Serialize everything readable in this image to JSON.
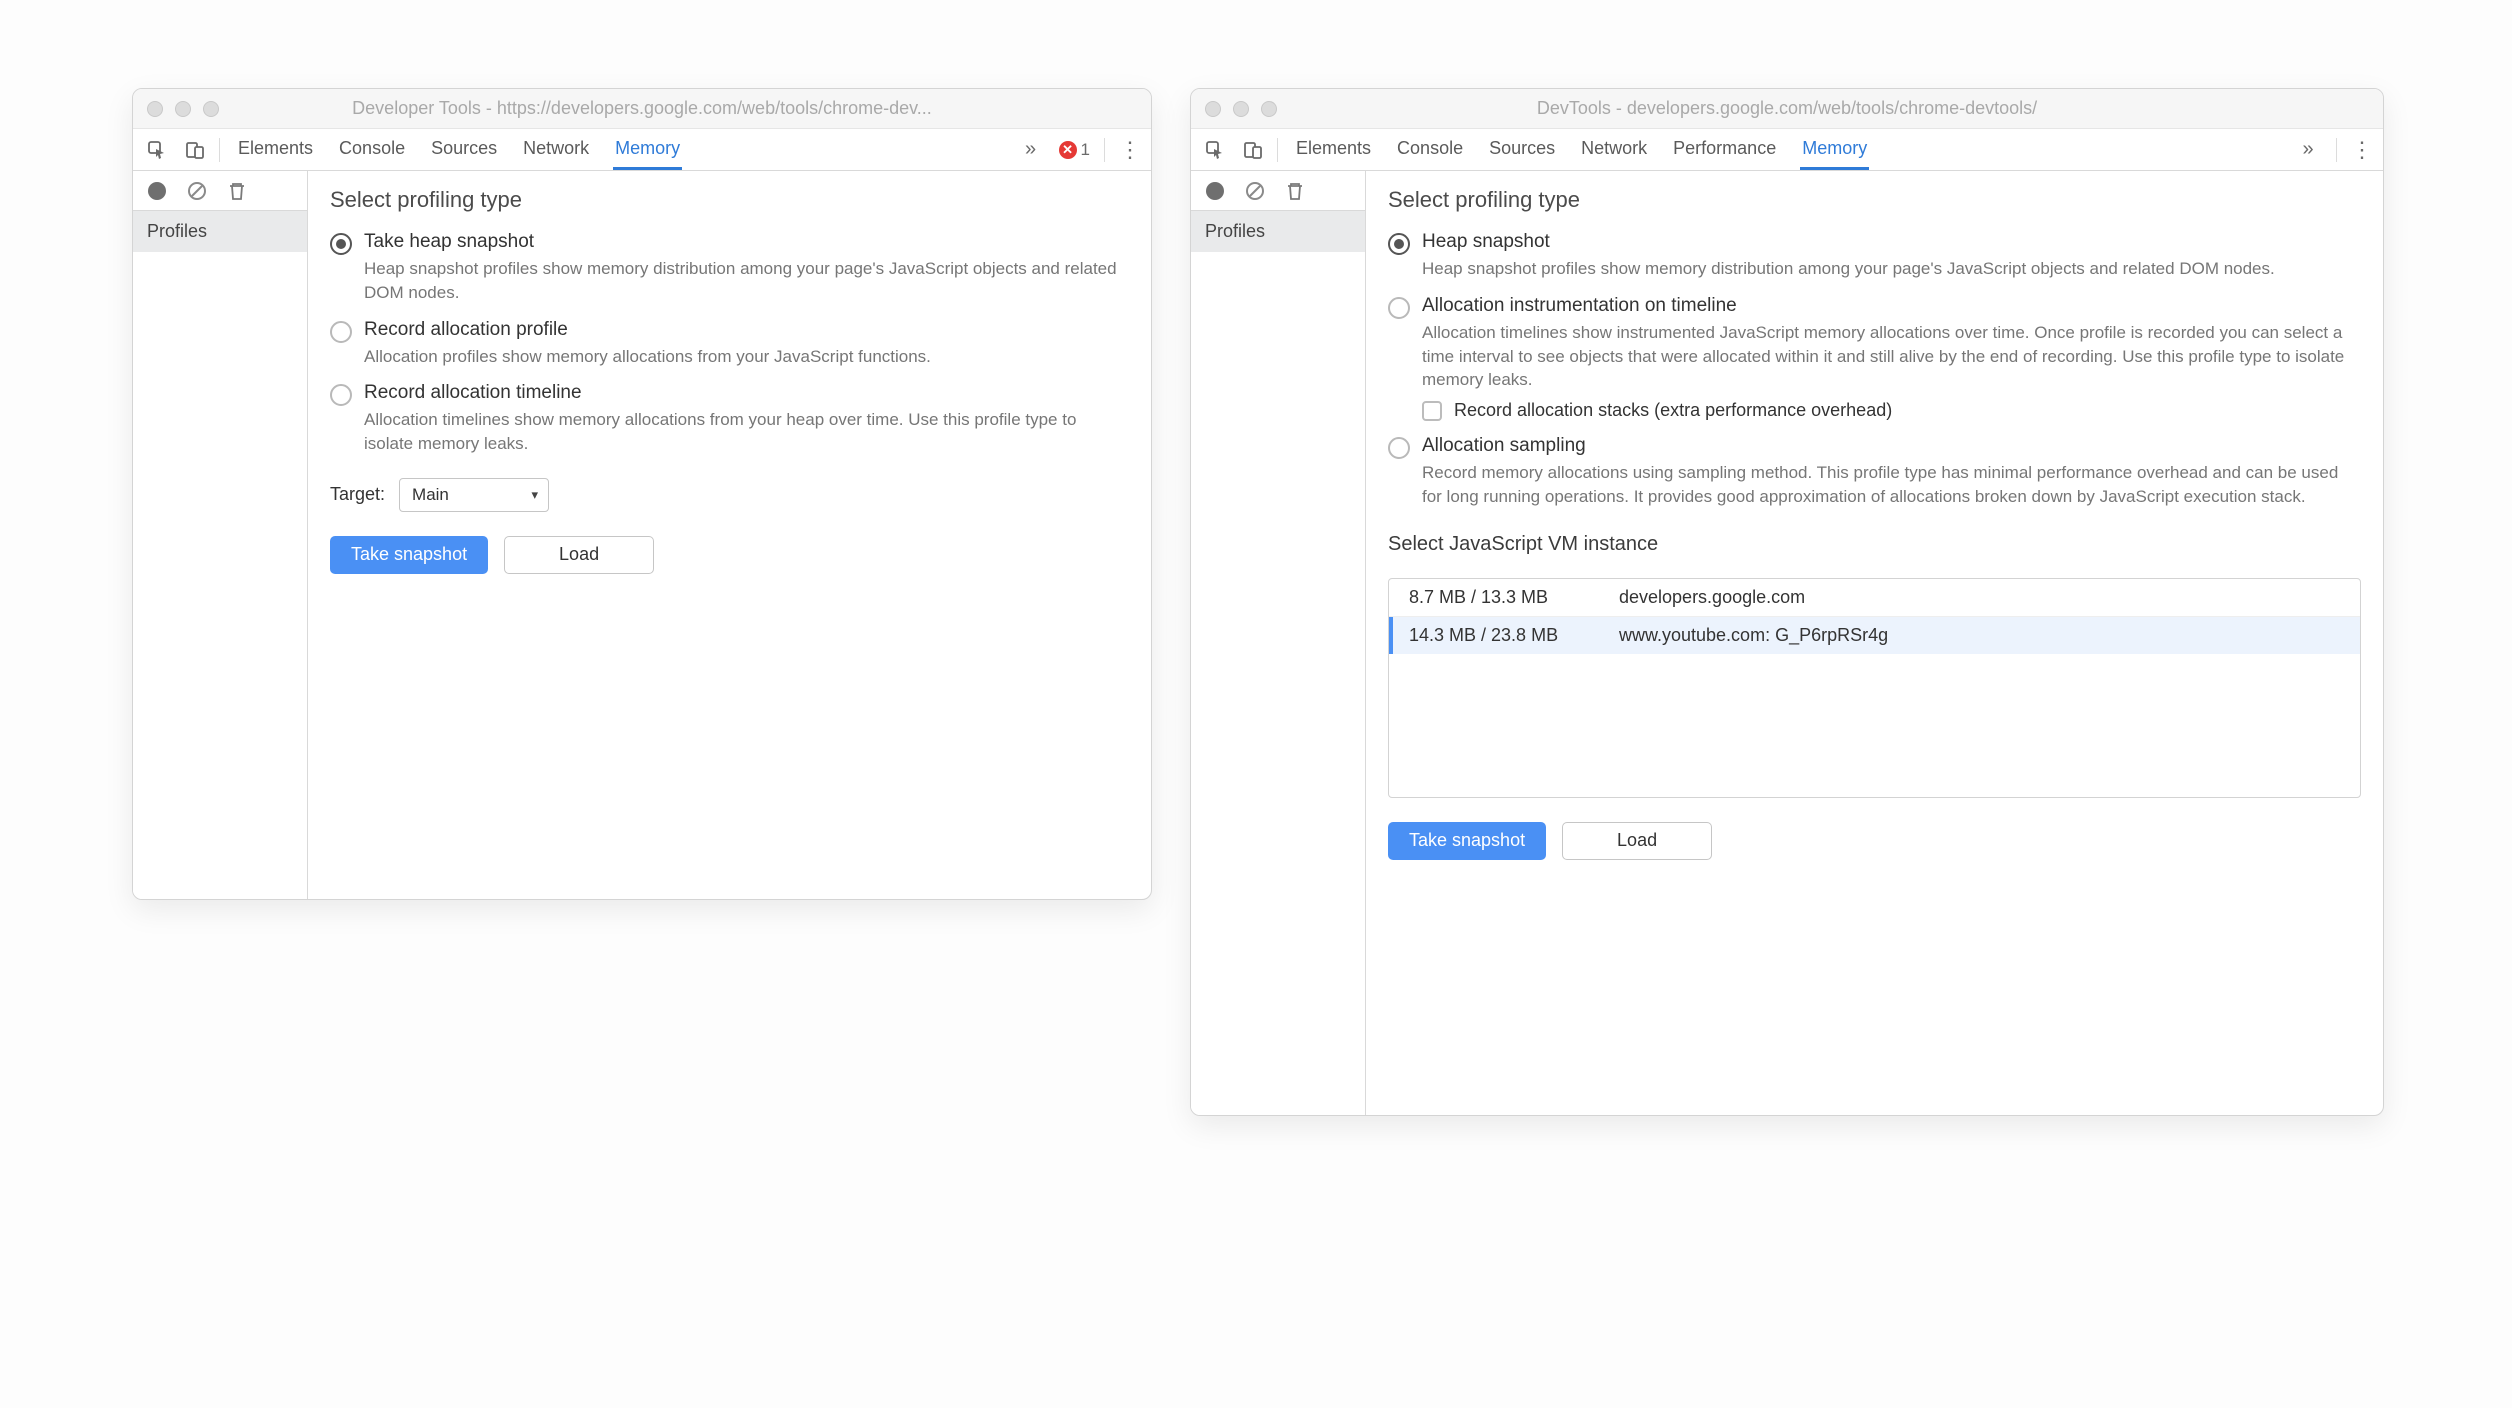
{
  "left": {
    "title": "Developer Tools - https://developers.google.com/web/tools/chrome-dev...",
    "tabs": [
      "Elements",
      "Console",
      "Sources",
      "Network",
      "Memory"
    ],
    "active_tab": "Memory",
    "error_count": "1",
    "sidebar": {
      "items": [
        "Profiles"
      ]
    },
    "content": {
      "heading": "Select profiling type",
      "options": [
        {
          "title": "Take heap snapshot",
          "desc": "Heap snapshot profiles show memory distribution among your page's JavaScript objects and related DOM nodes.",
          "selected": true
        },
        {
          "title": "Record allocation profile",
          "desc": "Allocation profiles show memory allocations from your JavaScript functions.",
          "selected": false
        },
        {
          "title": "Record allocation timeline",
          "desc": "Allocation timelines show memory allocations from your heap over time. Use this profile type to isolate memory leaks.",
          "selected": false
        }
      ],
      "target_label": "Target:",
      "target_value": "Main",
      "primary_btn": "Take snapshot",
      "secondary_btn": "Load"
    }
  },
  "right": {
    "title": "DevTools - developers.google.com/web/tools/chrome-devtools/",
    "tabs": [
      "Elements",
      "Console",
      "Sources",
      "Network",
      "Performance",
      "Memory"
    ],
    "active_tab": "Memory",
    "sidebar": {
      "items": [
        "Profiles"
      ]
    },
    "content": {
      "heading": "Select profiling type",
      "options": [
        {
          "title": "Heap snapshot",
          "desc": "Heap snapshot profiles show memory distribution among your page's JavaScript objects and related DOM nodes.",
          "selected": true
        },
        {
          "title": "Allocation instrumentation on timeline",
          "desc": "Allocation timelines show instrumented JavaScript memory allocations over time. Once profile is recorded you can select a time interval to see objects that were allocated within it and still alive by the end of recording. Use this profile type to isolate memory leaks.",
          "selected": false,
          "sub_checkbox": "Record allocation stacks (extra performance overhead)"
        },
        {
          "title": "Allocation sampling",
          "desc": "Record memory allocations using sampling method. This profile type has minimal performance overhead and can be used for long running operations. It provides good approximation of allocations broken down by JavaScript execution stack.",
          "selected": false
        }
      ],
      "vm_heading": "Select JavaScript VM instance",
      "vm_rows": [
        {
          "mem": "8.7 MB / 13.3 MB",
          "host": "developers.google.com",
          "selected": false
        },
        {
          "mem": "14.3 MB / 23.8 MB",
          "host": "www.youtube.com: G_P6rpRSr4g",
          "selected": true
        }
      ],
      "primary_btn": "Take snapshot",
      "secondary_btn": "Load"
    }
  }
}
